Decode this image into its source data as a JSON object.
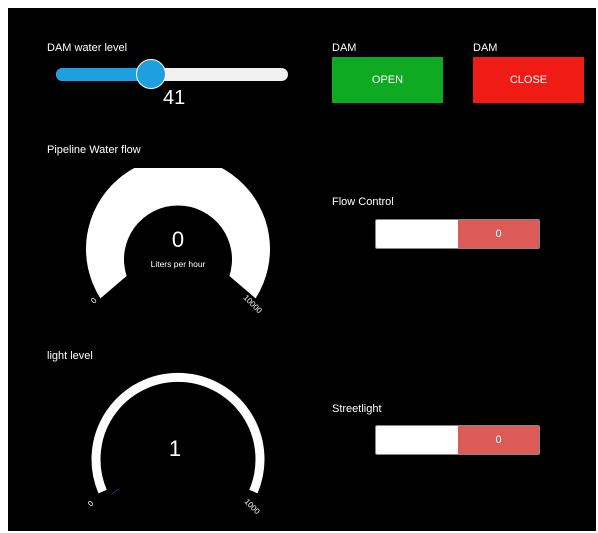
{
  "dam_level": {
    "label": "DAM water level",
    "value": 41,
    "value_text": "41",
    "min": 0,
    "max": 100
  },
  "dam_buttons": {
    "open": {
      "heading": "DAM",
      "label": "OPEN",
      "color": "#0eaa21"
    },
    "close": {
      "heading": "DAM",
      "label": "CLOSE",
      "color": "#ef1b14"
    }
  },
  "pipeline_flow": {
    "label": "Pipeline Water flow",
    "value": 0,
    "value_text": "0",
    "unit": "Liters per hour",
    "min_label": "0",
    "max_label": "10000",
    "min": 0,
    "max": 10000
  },
  "flow_control": {
    "label": "Flow Control",
    "state_text": "0",
    "active_color": "#dc5a58"
  },
  "light_level": {
    "label": "light level",
    "value": 1,
    "value_text": "1",
    "min_label": "0",
    "max_label": "1000",
    "min": 0,
    "max": 1000
  },
  "streetlight": {
    "label": "Streetlight",
    "state_text": "0",
    "active_color": "#dc5a58"
  }
}
